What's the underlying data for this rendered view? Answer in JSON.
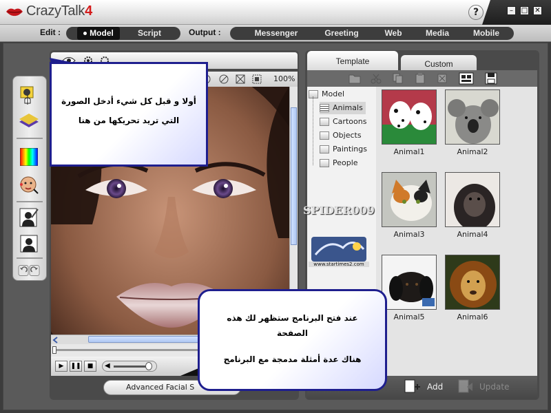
{
  "app": {
    "name": "CrazyTalk",
    "version": "4",
    "help": "?"
  },
  "window_buttons": {
    "minimize": "–",
    "maximize": "□",
    "close": "✕"
  },
  "menu": {
    "edit_label": "Edit :",
    "edit_items": [
      "Model",
      "Script"
    ],
    "active_edit": "Model",
    "output_label": "Output :",
    "output_items": [
      "Messenger",
      "Greeting",
      "Web",
      "Media",
      "Mobile"
    ]
  },
  "preview": {
    "zoom": "100%",
    "facial_button": "Advanced Facial S"
  },
  "library": {
    "tabs": [
      "Template",
      "Custom"
    ],
    "active_tab": "Template",
    "tree_root": "Model",
    "tree_items": [
      "Animals",
      "Cartoons",
      "Objects",
      "Paintings",
      "People"
    ],
    "selected_tree_item": "Animals",
    "thumbnails": [
      "Animal1",
      "Animal2",
      "Animal3",
      "Animal4",
      "Animal5",
      "Animal6"
    ],
    "add_label": "Add",
    "update_label": "Update"
  },
  "callouts": {
    "top_line1": "أولا و قبل كل شيء أدخل الصورة",
    "top_line2": "التي تريد تحريكها من هنا",
    "bottom_line1": "عند فتح البرنامج ستظهر لك هذه",
    "bottom_line2": "الصفحة",
    "bottom_line3": "هناك عدة أمثلة مدمجة مع البرنامج"
  },
  "watermark": {
    "text": "SPIDER009",
    "site": "www.startimes2.com"
  },
  "colors": {
    "accent": "#d41a1a",
    "callout_border": "#1e1e8e",
    "pill_bg": "#3d3d3d"
  }
}
